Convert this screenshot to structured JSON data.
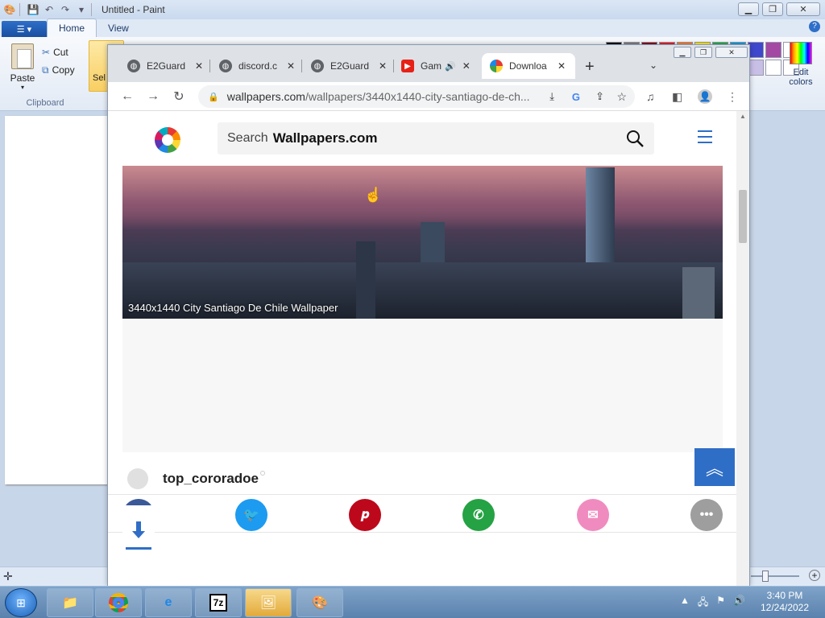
{
  "paint": {
    "title": "Untitled - Paint",
    "tabs": [
      "Home",
      "View"
    ],
    "paste_label": "Paste",
    "cut_label": "Cut",
    "copy_label": "Copy",
    "clipboard_group": "Clipboard",
    "select_label": "Sel",
    "edit_colors_label": "Edit colors",
    "palette": [
      "#000000",
      "#7f7f7f",
      "#880015",
      "#ed1c24",
      "#ff7f27",
      "#fff200",
      "#22b14c",
      "#00a2e8",
      "#3f48cc",
      "#a349a4",
      "#ffffff",
      "#c3c3c3",
      "#b97a57",
      "#ffaec9",
      "#ffc90e",
      "#efe4b0",
      "#b5e61d",
      "#99d9ea",
      "#7092be",
      "#c8bfe7",
      "#ffffff",
      "#ffffff"
    ]
  },
  "browser": {
    "tabs": [
      {
        "label": "E2Guard",
        "icon": "globe-icon"
      },
      {
        "label": "discord.c",
        "icon": "globe-icon"
      },
      {
        "label": "E2Guard",
        "icon": "globe-icon"
      },
      {
        "label": "Gam",
        "icon": "youtube-icon"
      },
      {
        "label": "Downloa",
        "icon": "wallpapers-icon"
      }
    ],
    "url_domain": "wallpapers.com",
    "url_path": "/wallpapers/3440x1440-city-santiago-de-ch..."
  },
  "page": {
    "search_label": "Search",
    "search_brand": "Wallpapers.com",
    "image_caption": "3440x1440 City Santiago De Chile Wallpaper",
    "username": "top_cororadoe",
    "share_buttons": [
      {
        "name": "facebook-share-button",
        "color": "#3b5998"
      },
      {
        "name": "twitter-share-button",
        "color": "#1d9bf0"
      },
      {
        "name": "pinterest-share-button",
        "color": "#bd081c"
      },
      {
        "name": "whatsapp-share-button",
        "color": "#25a244"
      },
      {
        "name": "email-share-button",
        "color": "#f08bbf"
      },
      {
        "name": "more-share-button",
        "color": "#9e9e9e"
      }
    ]
  },
  "taskbar": {
    "time": "3:40 PM",
    "date": "12/24/2022"
  }
}
